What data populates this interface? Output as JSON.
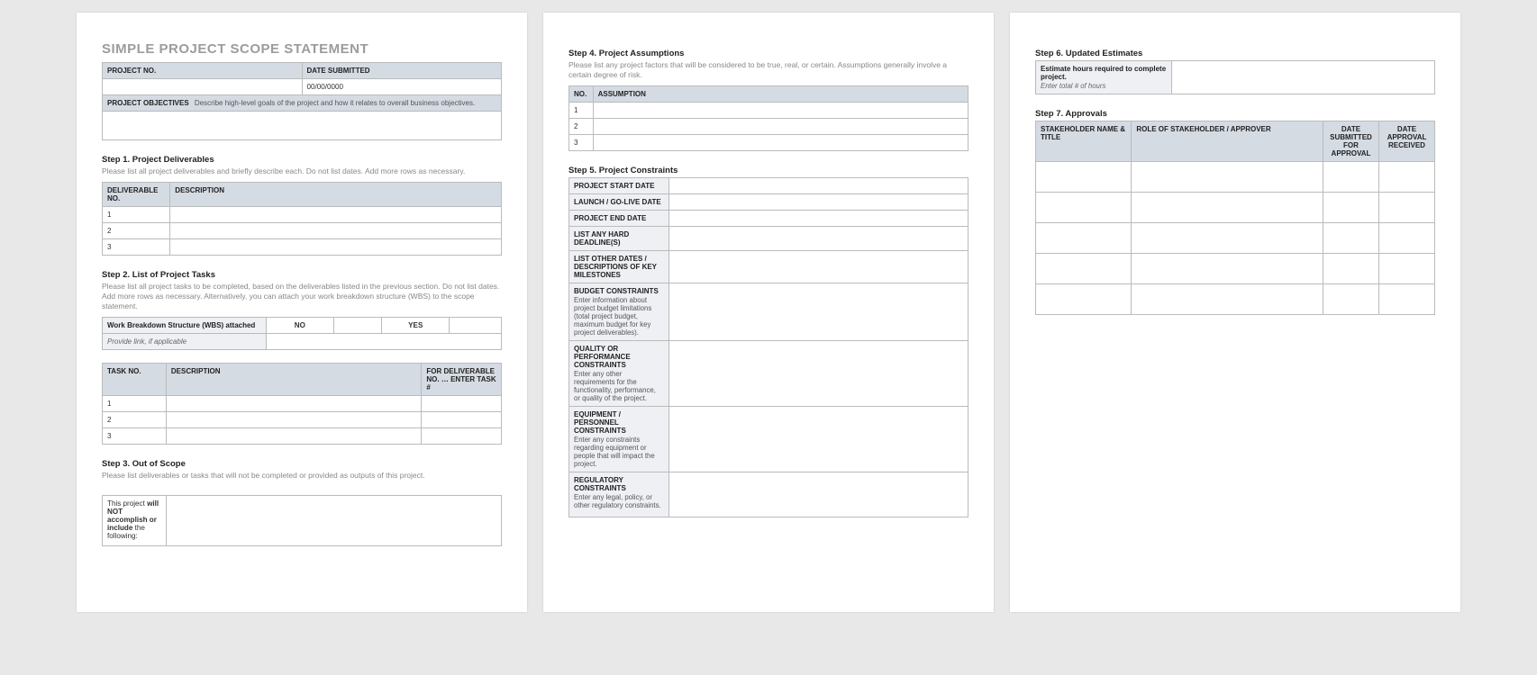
{
  "title": "SIMPLE PROJECT SCOPE STATEMENT",
  "meta": {
    "projectNoLabel": "PROJECT NO.",
    "dateSubmittedLabel": "DATE SUBMITTED",
    "projectNoValue": "",
    "dateSubmittedValue": "00/00/0000",
    "objectivesLabel": "PROJECT OBJECTIVES",
    "objectivesDesc": "Describe high-level goals of the project and how it relates to overall business objectives.",
    "objectivesValue": ""
  },
  "step1": {
    "title": "Step 1. Project Deliverables",
    "desc": "Please list all project deliverables and briefly describe each. Do not list dates. Add more rows as necessary.",
    "colNo": "DELIVERABLE NO.",
    "colDesc": "DESCRIPTION",
    "rows": [
      "1",
      "2",
      "3"
    ]
  },
  "step2": {
    "title": "Step 2. List of Project Tasks",
    "desc": "Please list all project tasks to be completed, based on the deliverables listed in the previous section. Do not list dates. Add more rows as necessary. Alternatively, you can attach your work breakdown structure (WBS) to the scope statement.",
    "wbsLabel": "Work Breakdown Structure (WBS) attached",
    "no": "NO",
    "yes": "YES",
    "provideLink": "Provide link, if applicable",
    "colTask": "TASK NO.",
    "colDesc": "DESCRIPTION",
    "colFor": "FOR DELIVERABLE NO. … ENTER TASK #",
    "rows": [
      "1",
      "2",
      "3"
    ]
  },
  "step3": {
    "title": "Step 3. Out of Scope",
    "desc": "Please list deliverables or tasks that will not be completed or provided as outputs of this project.",
    "label1": "This project ",
    "labelBold": "will NOT accomplish or include",
    "label2": " the following:"
  },
  "step4": {
    "title": "Step 4. Project Assumptions",
    "desc": "Please list any project factors that will be considered to be true, real, or certain. Assumptions generally involve a certain degree of risk.",
    "colNo": "NO.",
    "colAssumption": "ASSUMPTION",
    "rows": [
      "1",
      "2",
      "3"
    ]
  },
  "step5": {
    "title": "Step 5. Project Constraints",
    "labels": {
      "start": "PROJECT START DATE",
      "golive": "LAUNCH / GO-LIVE DATE",
      "end": "PROJECT END DATE",
      "deadlines": "LIST ANY HARD DEADLINE(S)",
      "milestones": "LIST OTHER DATES / DESCRIPTIONS OF KEY MILESTONES",
      "budget": "BUDGET CONSTRAINTS",
      "budgetSub": "Enter information about project budget limitations (total project budget, maximum budget for key project deliverables).",
      "quality": "QUALITY OR PERFORMANCE CONSTRAINTS",
      "qualitySub": "Enter any other requirements for the functionality, performance, or quality of the project.",
      "equipment": "EQUIPMENT / PERSONNEL CONSTRAINTS",
      "equipmentSub": "Enter any constraints regarding equipment or people that will impact the project.",
      "regulatory": "REGULATORY CONSTRAINTS",
      "regulatorySub": "Enter any legal, policy, or other regulatory constraints."
    }
  },
  "step6": {
    "title": "Step 6. Updated Estimates",
    "label": "Estimate hours required to complete project.",
    "sub": "Enter total # of hours"
  },
  "step7": {
    "title": "Step 7. Approvals",
    "colName": "STAKEHOLDER NAME & TITLE",
    "colRole": "ROLE OF STAKEHOLDER / APPROVER",
    "colSubmitted": "DATE SUBMITTED FOR APPROVAL",
    "colReceived": "DATE APPROVAL RECEIVED"
  }
}
